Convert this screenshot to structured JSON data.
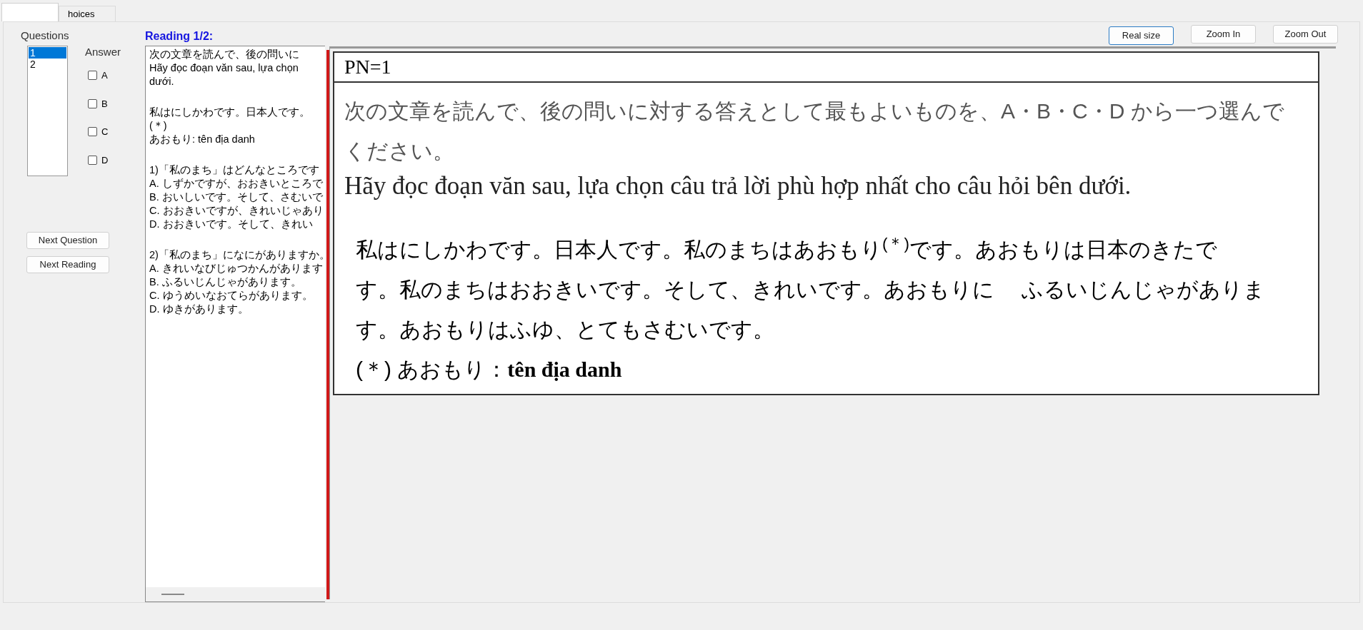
{
  "tabs": [
    {
      "selected": true
    },
    {
      "label": "hoices",
      "selected": false
    }
  ],
  "questions": {
    "title": "Questions",
    "items": [
      {
        "label": "1",
        "selected": true
      },
      {
        "label": "2",
        "selected": false
      }
    ]
  },
  "answer": {
    "title": "Answer",
    "options": [
      {
        "label": "A",
        "checked": false
      },
      {
        "label": "B",
        "checked": false
      },
      {
        "label": "C",
        "checked": false
      },
      {
        "label": "D",
        "checked": false
      }
    ]
  },
  "buttons": [
    "Next Question",
    "Next Reading"
  ],
  "reading_title": "Reading 1/2:",
  "reading_text": [
    [
      "次の文章を読んで、後の問いに",
      "Hãy đọc đoạn văn sau, lựa chọn",
      "dưới."
    ],
    [
      "私はにしかわです。日本人です。",
      "(＊)",
      "あおもり: tên địa danh"
    ],
    [
      "1)「私のまち」はどんなところです",
      "A.  しずかですが、おおきいところで",
      "B.  おいしいです。そして、さむいで",
      "C.  おおきいですが、きれいじゃあり",
      "D.  おおきいです。そして、きれい"
    ],
    [
      "2)「私のまち」になにがありますか。",
      "A.  きれいなびじゅつかんがあります",
      "B.  ふるいじんじゃがあります。",
      "C.  ゆうめいなおてらがあります。",
      "D.  ゆきがあります。"
    ]
  ],
  "view_buttons": [
    {
      "label": "Real size",
      "selected": true
    },
    {
      "label": "Zoom In",
      "selected": false
    },
    {
      "label": "Zoom Out",
      "selected": false
    }
  ],
  "document": {
    "header": "PN=1",
    "instruction_ja": [
      "次の文章を読んで、後の問いに対する答えとして最もよいものを、A・B・C・D から一つ選んで",
      "ください。"
    ],
    "instruction_vi": "Hãy đọc đoạn văn sau, lựa chọn câu trả lời phù hợp nhất cho câu hỏi bên dưới.",
    "passage": [
      "私はにしかわです。日本人です。私のまちはあおもり$^{(＊)}$です。あおもりは日本のきたで",
      "す。私のまちはおおきいです。そして、きれいです。あおもりに　 ふるいじんじゃがありま",
      "す。あおもりはふゆ、とてもさむいです。"
    ],
    "footnote": "(＊) あおもり：**tên địa danh**"
  }
}
